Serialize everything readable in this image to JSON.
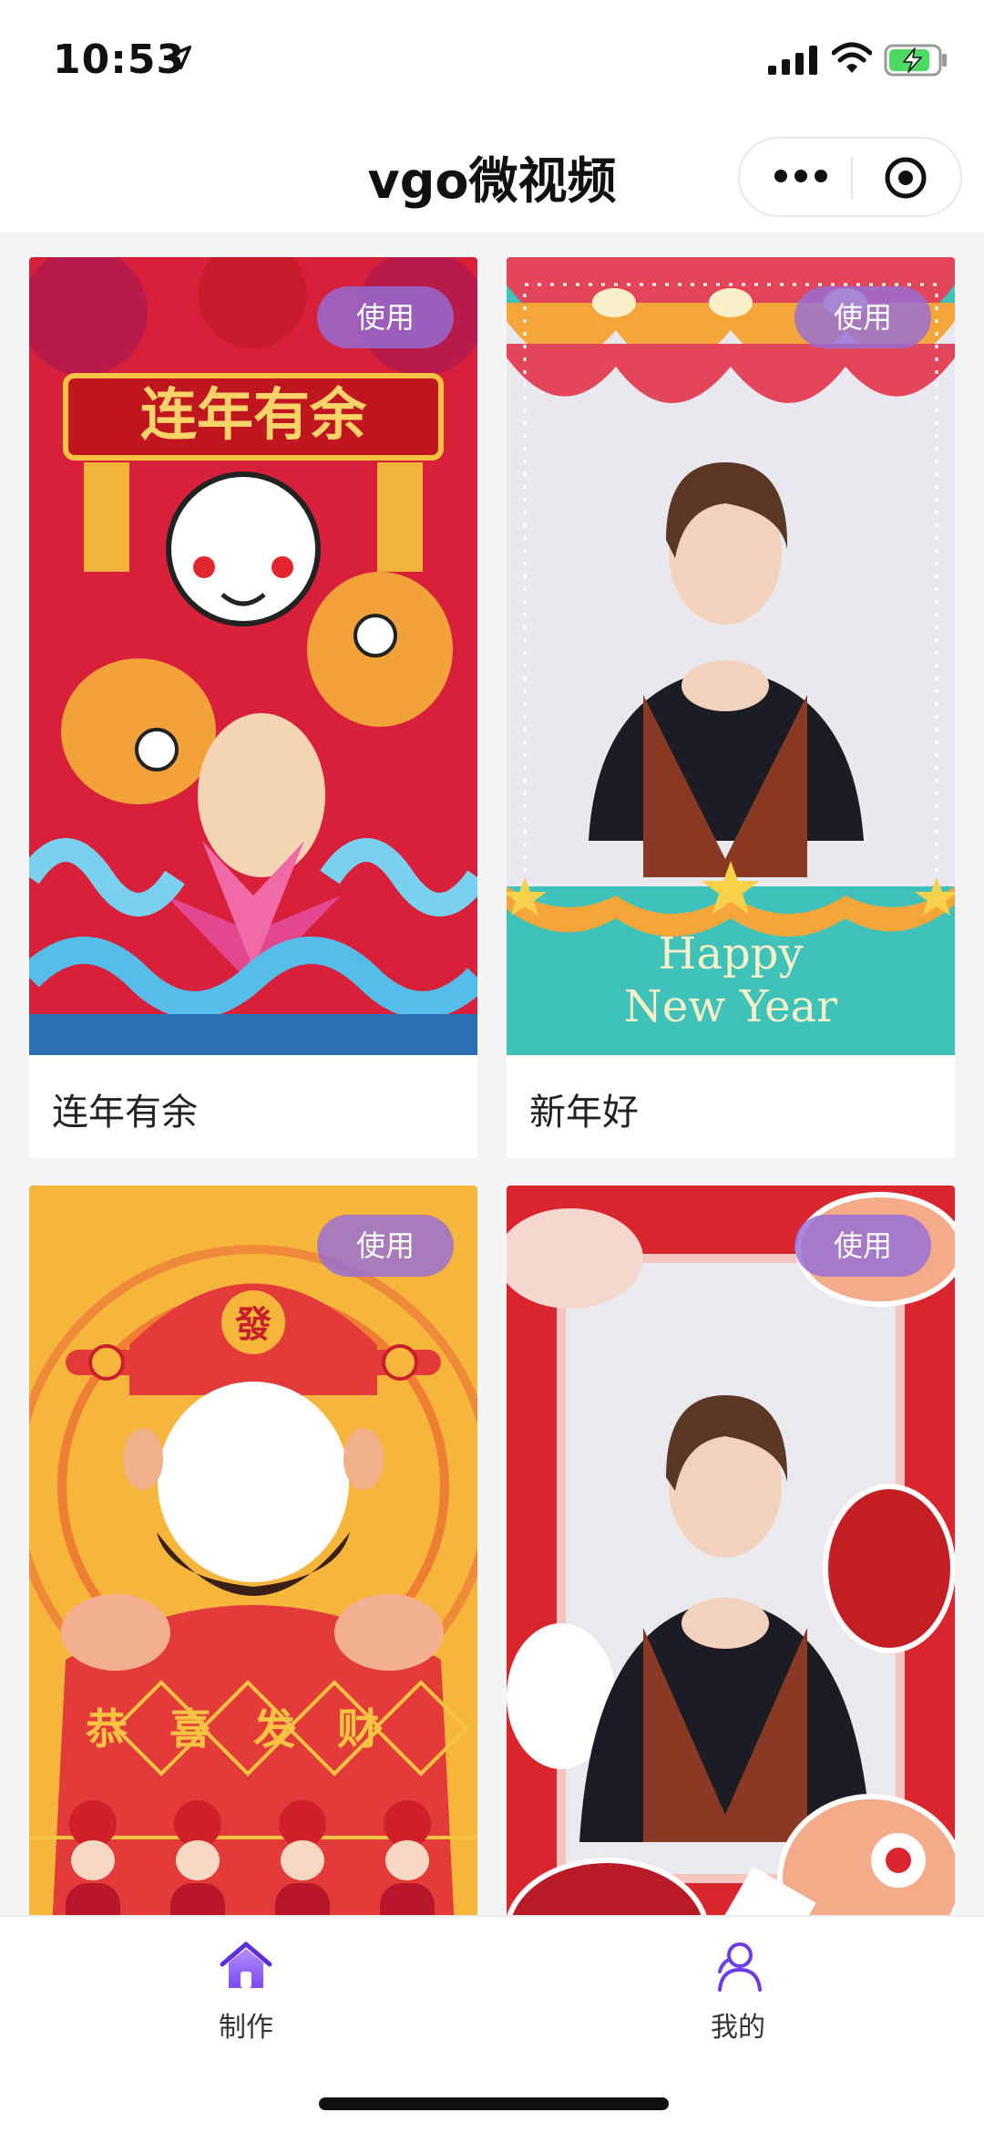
{
  "status_bar": {
    "time": "10:53"
  },
  "header": {
    "title": "vgo微视频"
  },
  "templates": [
    {
      "title": "连年有余",
      "use_label": "使用",
      "art_text": "连年有余"
    },
    {
      "title": "新年好",
      "use_label": "使用",
      "art_text_1": "Happy",
      "art_text_2": "New Year"
    },
    {
      "title": "",
      "use_label": "使用",
      "art_text": "恭喜发财",
      "seal_text": "發"
    },
    {
      "title": "",
      "use_label": "使用"
    }
  ],
  "tab_bar": {
    "items": [
      {
        "label": "制作",
        "icon": "home-icon",
        "active": true
      },
      {
        "label": "我的",
        "icon": "user-icon",
        "active": false
      }
    ]
  },
  "colors": {
    "accent": "#8a5cf6",
    "use_button": "#966ed7",
    "battery": "#4cd964"
  }
}
